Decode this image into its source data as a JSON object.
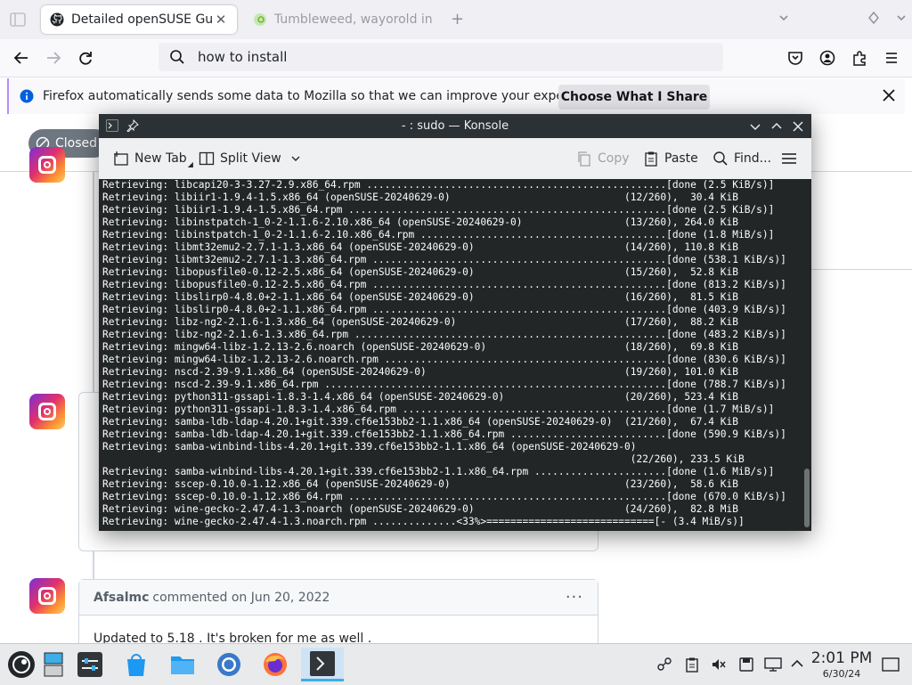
{
  "browser": {
    "tabs": [
      {
        "label": "Detailed openSUSE Guide",
        "active": true
      },
      {
        "label": "Tumbleweed, wayorold ins",
        "active": false
      }
    ],
    "url_value": "how to install",
    "notification": {
      "text": "Firefox automatically sends some data to Mozilla so that we can improve your experience.",
      "button": "Choose What I Share"
    }
  },
  "page": {
    "closed_badge": "Closed",
    "comment": {
      "author": "Afsalmc",
      "meta": "commented on Jun 20, 2022",
      "body": "Updated to 5.18 . It's broken for me as well ."
    }
  },
  "konsole": {
    "title": "- : sudo — Konsole",
    "toolbar": {
      "new_tab": "New Tab",
      "split_view": "Split View",
      "copy": "Copy",
      "paste": "Paste",
      "find": "Find..."
    },
    "lines": [
      "Retrieving: libcapi20-3-3.27-2.9.x86_64.rpm ..................................................[done (2.5 KiB/s)]",
      "Retrieving: libiir1-1.9.4-1.5.x86_64 (openSUSE-20240629-0)                             (12/260),  30.4 KiB",
      "Retrieving: libiir1-1.9.4-1.5.x86_64.rpm .....................................................[done (2.5 KiB/s)]",
      "Retrieving: libinstpatch-1_0-2-1.1.6-2.10.x86_64 (openSUSE-20240629-0)                 (13/260), 264.0 KiB",
      "Retrieving: libinstpatch-1_0-2-1.1.6-2.10.x86_64.rpm .........................................[done (1.8 MiB/s)]",
      "Retrieving: libmt32emu2-2.7.1-1.3.x86_64 (openSUSE-20240629-0)                         (14/260), 110.8 KiB",
      "Retrieving: libmt32emu2-2.7.1-1.3.x86_64.rpm .................................................[done (538.1 KiB/s)]",
      "Retrieving: libopusfile0-0.12-2.5.x86_64 (openSUSE-20240629-0)                         (15/260),  52.8 KiB",
      "Retrieving: libopusfile0-0.12-2.5.x86_64.rpm .................................................[done (813.2 KiB/s)]",
      "Retrieving: libslirp0-4.8.0+2-1.1.x86_64 (openSUSE-20240629-0)                         (16/260),  81.5 KiB",
      "Retrieving: libslirp0-4.8.0+2-1.1.x86_64.rpm .................................................[done (403.9 KiB/s)]",
      "Retrieving: libz-ng2-2.1.6-1.3.x86_64 (openSUSE-20240629-0)                            (17/260),  88.2 KiB",
      "Retrieving: libz-ng2-2.1.6-1.3.x86_64.rpm ....................................................[done (483.2 KiB/s)]",
      "Retrieving: mingw64-libz-1.2.13-2.6.noarch (openSUSE-20240629-0)                       (18/260),  69.8 KiB",
      "Retrieving: mingw64-libz-1.2.13-2.6.noarch.rpm ...............................................[done (830.6 KiB/s)]",
      "Retrieving: nscd-2.39-9.1.x86_64 (openSUSE-20240629-0)                                 (19/260), 101.0 KiB",
      "Retrieving: nscd-2.39-9.1.x86_64.rpm .........................................................[done (788.7 KiB/s)]",
      "Retrieving: python311-gssapi-1.8.3-1.4.x86_64 (openSUSE-20240629-0)                    (20/260), 523.4 KiB",
      "Retrieving: python311-gssapi-1.8.3-1.4.x86_64.rpm ............................................[done (1.7 MiB/s)]",
      "Retrieving: samba-ldb-ldap-4.20.1+git.339.cf6e153bb2-1.1.x86_64 (openSUSE-20240629-0)  (21/260),  67.4 KiB",
      "Retrieving: samba-ldb-ldap-4.20.1+git.339.cf6e153bb2-1.1.x86_64.rpm ..........................[done (590.9 KiB/s)]",
      "Retrieving: samba-winbind-libs-4.20.1+git.339.cf6e153bb2-1.1.x86_64 (openSUSE-20240629-0)",
      "                                                                                        (22/260), 233.5 KiB",
      "Retrieving: samba-winbind-libs-4.20.1+git.339.cf6e153bb2-1.1.x86_64.rpm ......................[done (1.6 MiB/s)]",
      "Retrieving: sscep-0.10.0-1.12.x86_64 (openSUSE-20240629-0)                             (23/260),  58.6 KiB",
      "Retrieving: sscep-0.10.0-1.12.x86_64.rpm .....................................................[done (670.0 KiB/s)]",
      "Retrieving: wine-gecko-2.47.4-1.3.noarch (openSUSE-20240629-0)                         (24/260),  82.8 MiB",
      "Retrieving: wine-gecko-2.47.4-1.3.noarch.rpm ..............<33%>============================[- (3.4 MiB/s)]"
    ]
  },
  "taskbar": {
    "time": "2:01 PM",
    "date": "6/30/24"
  },
  "colors": {
    "accent": "#3daee9",
    "terminal_bg": "#232627",
    "notification_bar": "#b58cff"
  }
}
